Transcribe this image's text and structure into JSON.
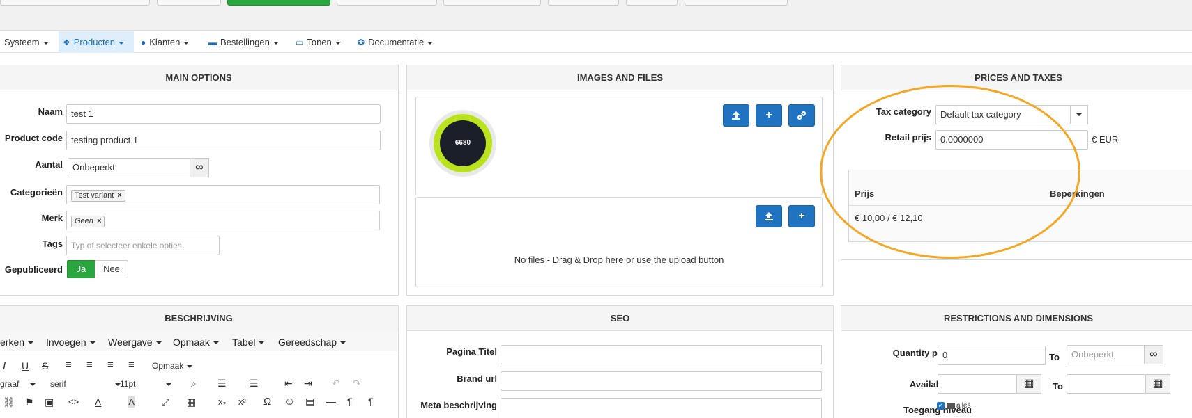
{
  "nav": {
    "items": [
      {
        "label": "Systeem"
      },
      {
        "label": "Producten"
      },
      {
        "label": "Klanten"
      },
      {
        "label": "Bestellingen"
      },
      {
        "label": "Tonen"
      },
      {
        "label": "Documentatie"
      }
    ]
  },
  "main_options": {
    "title": "MAIN OPTIONS",
    "naam_label": "Naam",
    "naam_value": "test 1",
    "code_label": "Product code",
    "code_value": "testing product 1",
    "aantal_label": "Aantal",
    "aantal_value": "Onbeperkt",
    "categorieen_label": "Categorieën",
    "categorie_tag": "Test variant",
    "merk_label": "Merk",
    "merk_tag": "Geen",
    "tags_label": "Tags",
    "tags_placeholder": "Typ of selecteer enkele opties",
    "gepubliceerd_label": "Gepubliceerd",
    "ja": "Ja",
    "nee": "Nee"
  },
  "images": {
    "title": "IMAGES AND FILES",
    "thumb_text": "6680",
    "no_files": "No files - Drag & Drop here or use the upload button"
  },
  "prices": {
    "title": "PRICES AND TAXES",
    "tax_label": "Tax category",
    "tax_value": "Default tax category",
    "retail_label": "Retail prijs",
    "retail_value": "0.0000000",
    "currency": "€ EUR",
    "col_prijs": "Prijs",
    "col_beperkingen": "Beperkingen",
    "row_price": "€ 10,00 / € 12,10"
  },
  "beschrijving": {
    "title": "BESCHRIJVING",
    "menus": [
      "erken",
      "Invoegen",
      "Weergave",
      "Opmaak",
      "Tabel",
      "Gereedschap"
    ],
    "opmaak_dropdown": "Opmaak",
    "block": "graaf",
    "font": "serif",
    "size": "11pt"
  },
  "seo": {
    "title": "SEO",
    "pagina_titel": "Pagina Titel",
    "brand_url": "Brand url",
    "meta": "Meta beschrijving"
  },
  "restrictions": {
    "title": "RESTRICTIONS AND DIMENSIONS",
    "qty_label": "Quantity per order",
    "qty_from": "0",
    "to1": "To",
    "qty_to": "Onbeperkt",
    "available_label": "Available from",
    "to2": "To",
    "toegang_label": "Toegang niveau",
    "alles": "alles"
  },
  "colors": {
    "primary": "#1f73c1",
    "success": "#2aa63f",
    "highlight_circle": "#f5a623"
  }
}
